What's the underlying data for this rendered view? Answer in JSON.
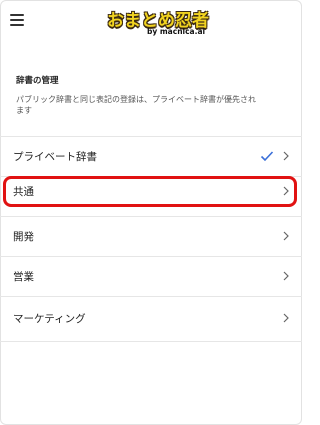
{
  "header": {
    "logo_main": "おまとめ忍者",
    "logo_by": "by macnica.ai"
  },
  "section": {
    "title": "辞書の管理",
    "description": "パブリック辞書と同じ表記の登録は、プライベート辞書が優先されます"
  },
  "dictionaries": [
    {
      "label": "プライベート辞書",
      "checked": true
    },
    {
      "label": "共通",
      "checked": false,
      "highlighted": true
    },
    {
      "label": "開発",
      "checked": false
    },
    {
      "label": "営業",
      "checked": false
    },
    {
      "label": "マーケティング",
      "checked": false
    }
  ],
  "colors": {
    "check": "#3a6fd8",
    "highlight": "#e11212",
    "logo_fill": "#f1d320"
  }
}
